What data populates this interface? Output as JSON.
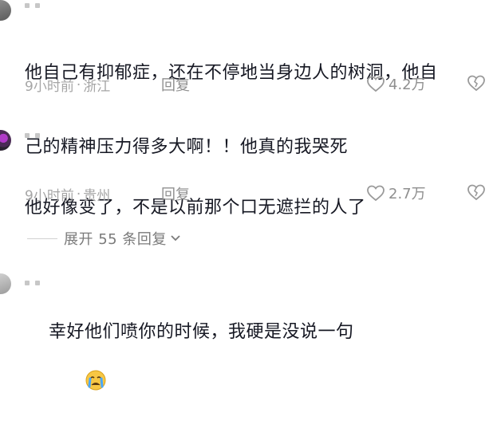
{
  "comments": [
    {
      "text_line1": "他自己有抑郁症，还在不停地当身边人的树洞，他自",
      "text_line2": "己的精神压力得多大啊！！他真的我哭死",
      "time": "9小时前",
      "location": "浙江",
      "reply_label": "回复",
      "likes": "4.2万"
    },
    {
      "text_line1": "他好像变了，不是以前那个口无遮拦的人了",
      "time": "9小时前",
      "location": "贵州",
      "reply_label": "回复",
      "likes": "2.7万"
    },
    {
      "text_line1": "幸好他们喷你的时候，我硬是没说一句"
    }
  ],
  "expand_replies_label": "展开 55 条回复",
  "meta_separator": "·",
  "icons": {
    "like": "heart-outline-icon",
    "dislike": "broken-heart-icon",
    "expand": "chevron-down-icon",
    "emoji": "crying-face-emoji"
  }
}
